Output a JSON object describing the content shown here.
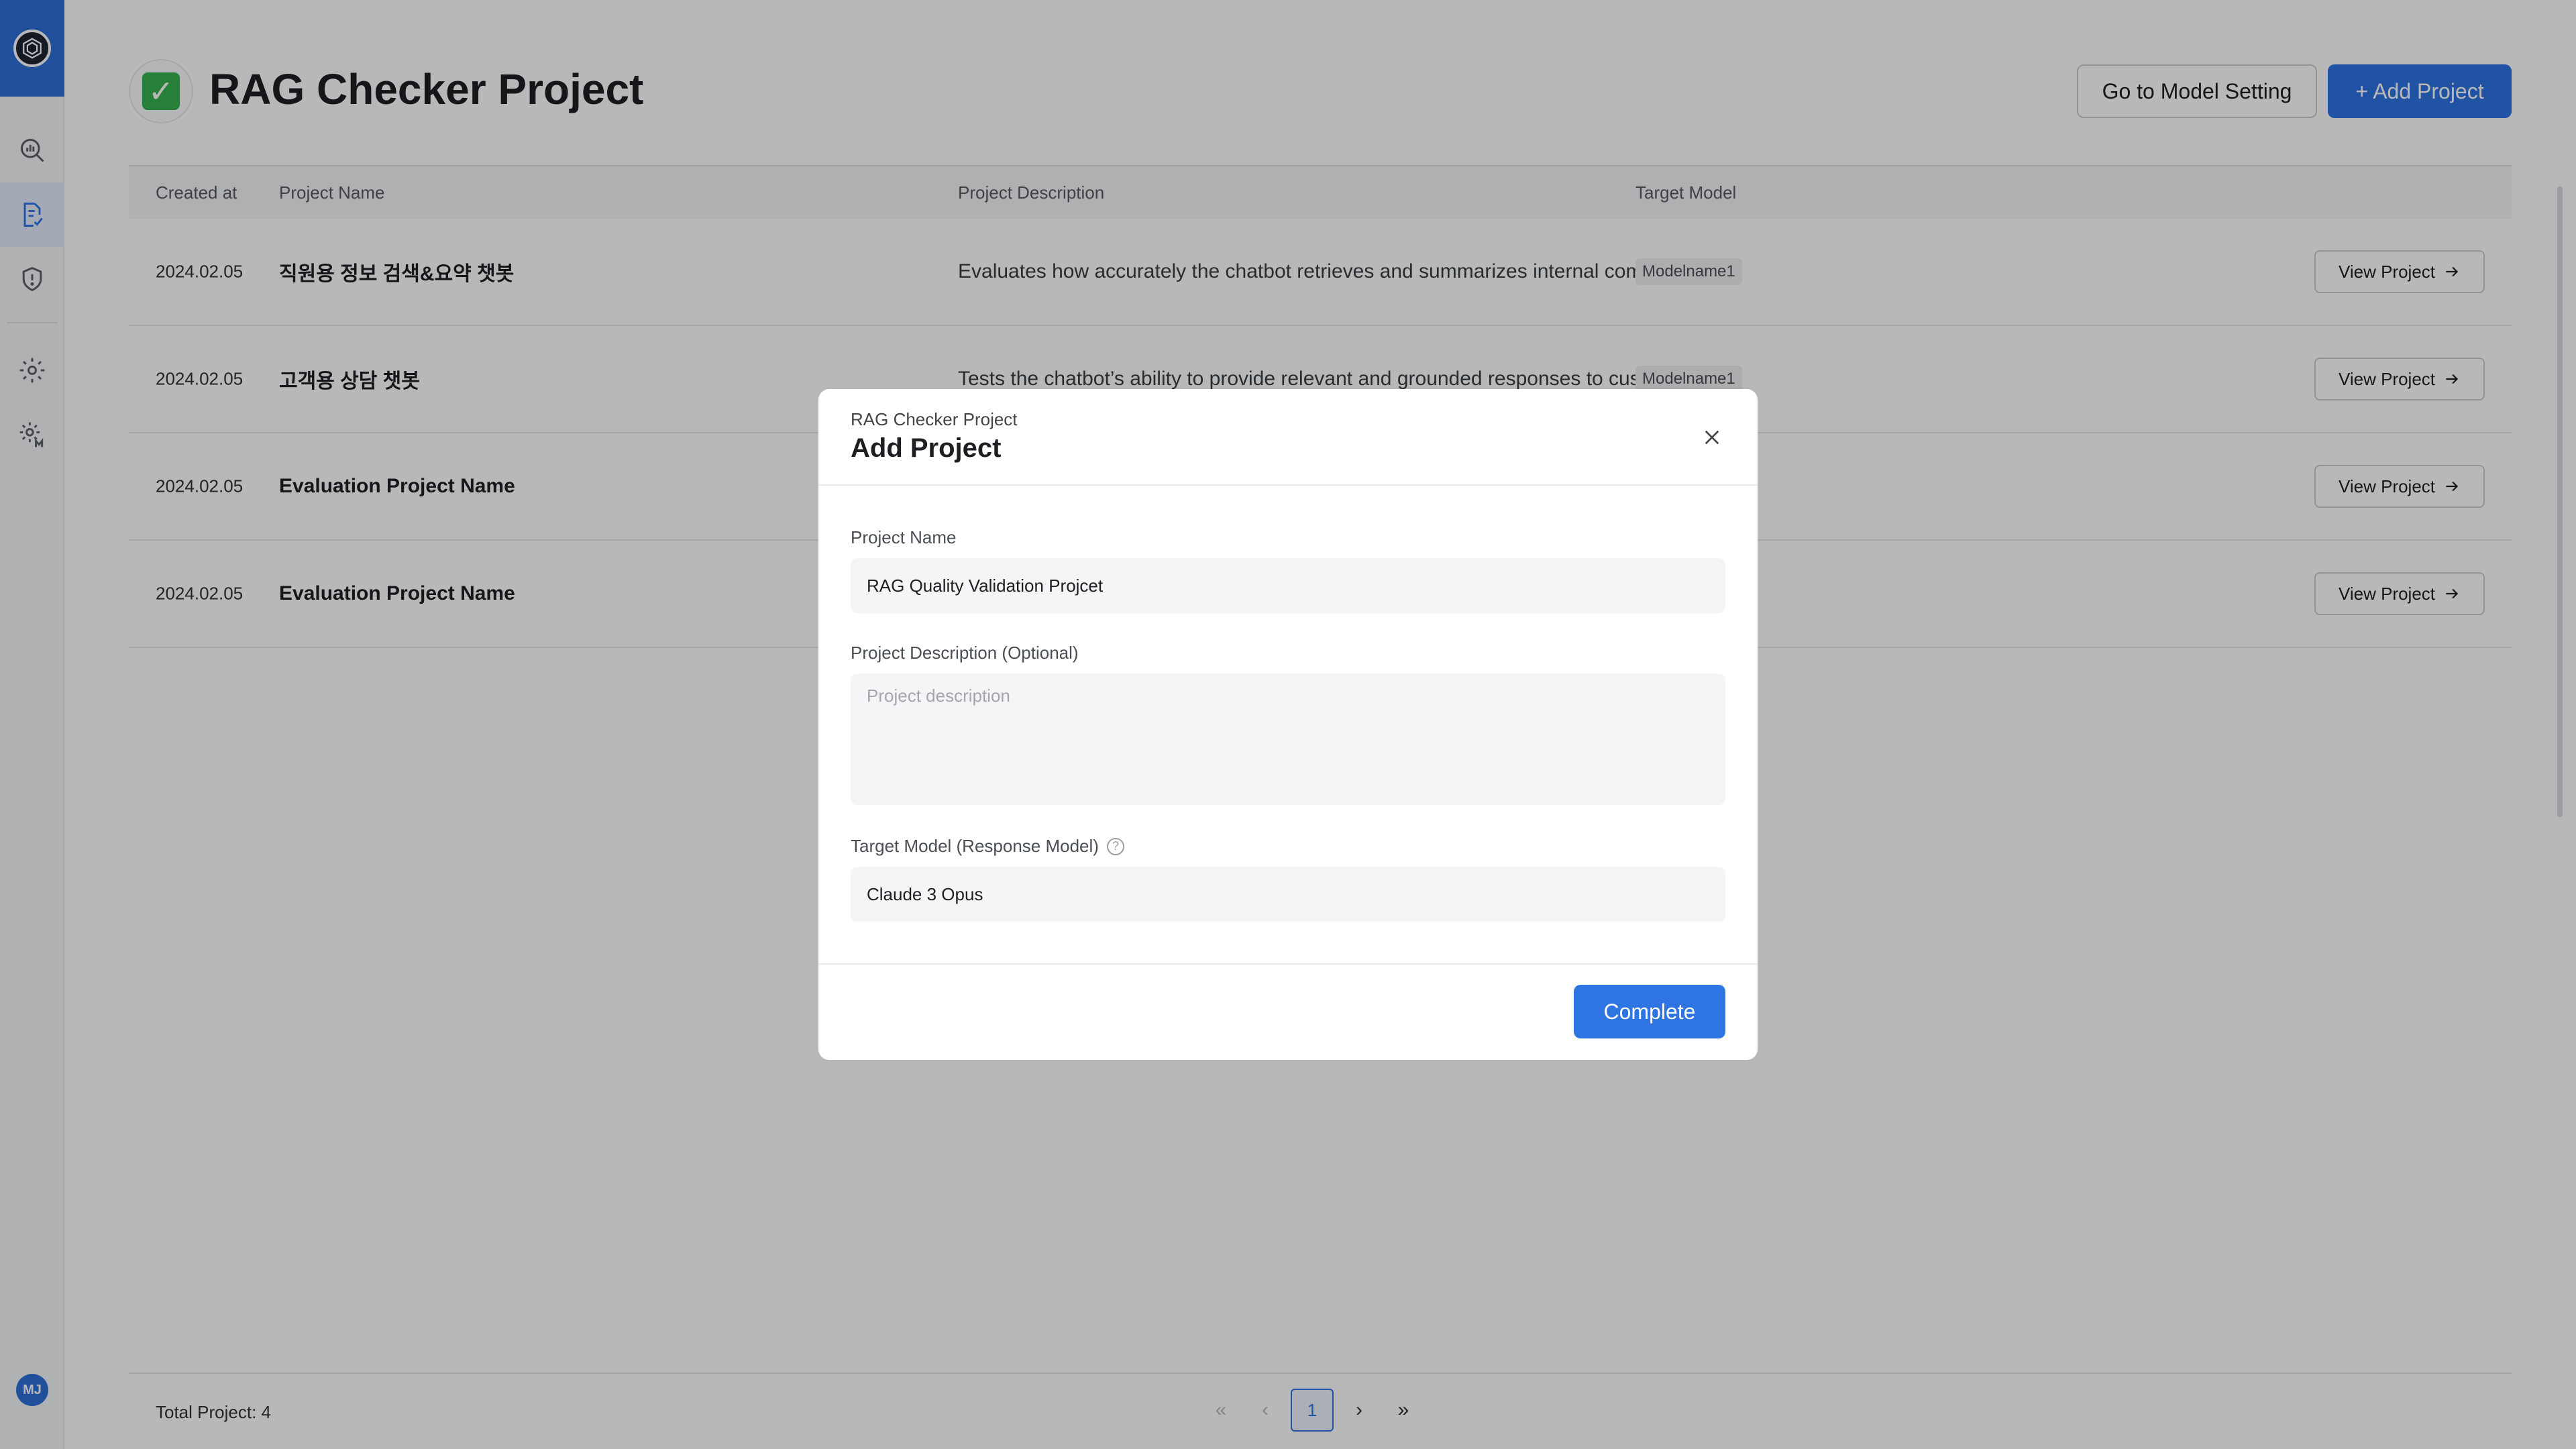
{
  "page": {
    "title": "RAG Checker Project",
    "title_icon": "check-mark-icon",
    "buttons": {
      "model_setting": "Go to Model Setting",
      "add_project": "+ Add Project"
    }
  },
  "sidebar": {
    "avatar_initials": "MJ",
    "items": [
      {
        "icon": "analytics-icon"
      },
      {
        "icon": "document-check-icon",
        "active": true
      },
      {
        "icon": "shield-alert-icon"
      },
      {
        "icon": "settings-icon"
      },
      {
        "icon": "model-settings-icon"
      }
    ]
  },
  "table": {
    "headers": {
      "created": "Created at",
      "name": "Project Name",
      "desc": "Project Description",
      "model": "Target Model"
    },
    "view_label": "View Project",
    "rows": [
      {
        "created": "2024.02.05",
        "name": "직원용 정보 검색&요약 챗봇",
        "desc": "Evaluates how accurately the chatbot retrieves and summarizes internal company documents",
        "model": "Modelname1"
      },
      {
        "created": "2024.02.05",
        "name": "고객용 상담 챗봇",
        "desc": "Tests the chatbot’s ability to provide relevant and grounded responses to customer inquiries",
        "model": "Modelname1"
      },
      {
        "created": "2024.02.05",
        "name": "Evaluation Project Name",
        "desc": "",
        "model": ""
      },
      {
        "created": "2024.02.05",
        "name": "Evaluation Project Name",
        "desc": "",
        "model": ""
      }
    ]
  },
  "footer": {
    "total": "Total Project: 4",
    "current_page": "1"
  },
  "modal": {
    "subtitle": "RAG Checker Project",
    "title": "Add Project",
    "name_label": "Project Name",
    "name_value": "RAG Quality Validation Projcet",
    "desc_label": "Project Description (Optional)",
    "desc_placeholder": "Project description",
    "model_label": "Target Model (Response Model)",
    "model_value": "Claude 3 Opus",
    "complete_label": "Complete"
  },
  "colors": {
    "primary": "#2f74e3",
    "check_green": "#37b24d"
  }
}
